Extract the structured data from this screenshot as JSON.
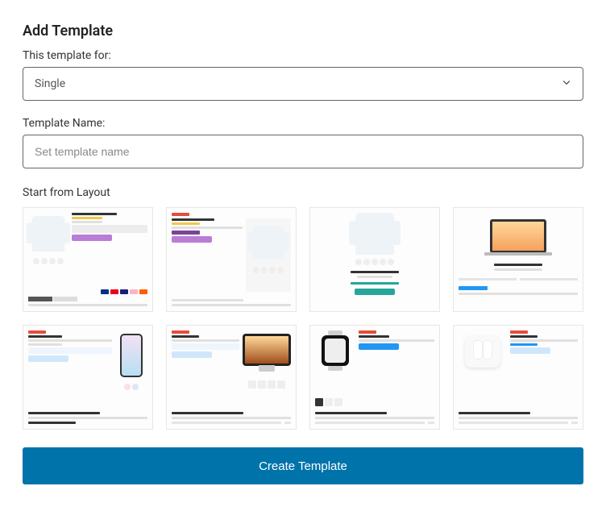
{
  "title": "Add Template",
  "fields": {
    "templateForLabel": "This template for:",
    "templateForValue": "Single",
    "templateNameLabel": "Template Name:",
    "templateNamePlaceholder": "Set template name"
  },
  "layoutSection": {
    "label": "Start from Layout"
  },
  "actions": {
    "createButton": "Create Template"
  }
}
